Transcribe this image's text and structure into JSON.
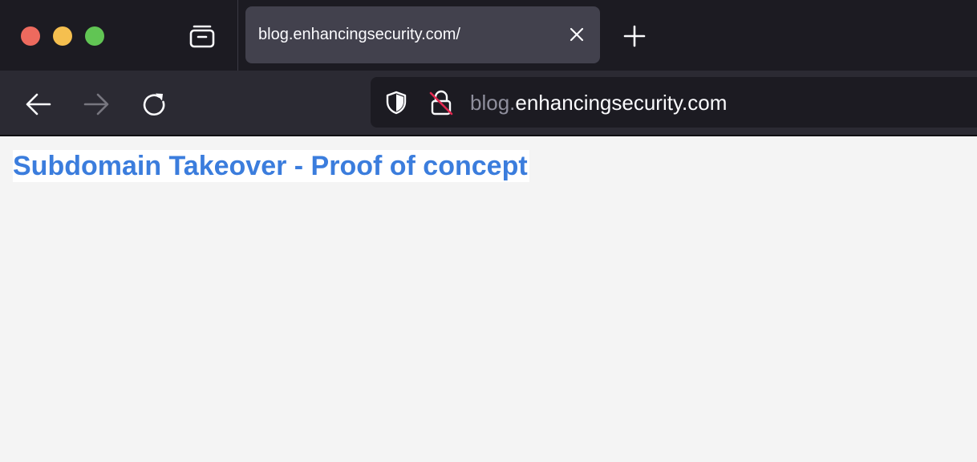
{
  "browser": {
    "tabs": [
      {
        "title": "blog.enhancingsecurity.com/",
        "active": true
      }
    ],
    "address_bar": {
      "subdomain": "blog.",
      "domain": "enhancingsecurity.com"
    },
    "icons": {
      "tab_list": "tab-list-icon",
      "close": "close-icon",
      "new_tab": "plus-icon",
      "back": "arrow-left-icon",
      "forward": "arrow-right-icon",
      "reload": "reload-icon",
      "tracking_protection": "shield-icon",
      "connection": "lock-insecure-icon"
    },
    "colors": {
      "close": "#ed6a5e",
      "minimize": "#f5bf4f",
      "maximize": "#61c554",
      "heading": "#3b7ddd"
    }
  },
  "page": {
    "heading": "Subdomain Takeover - Proof of concept"
  }
}
